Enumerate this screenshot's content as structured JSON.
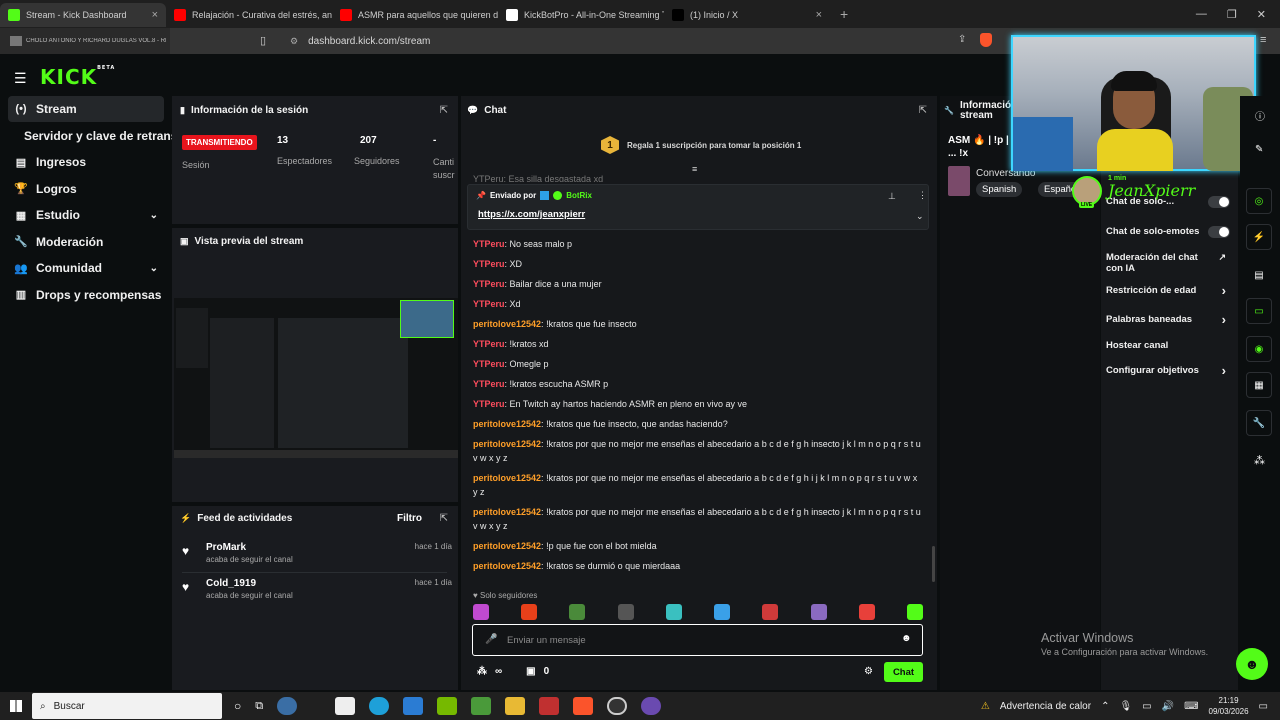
{
  "browser": {
    "tabs": [
      {
        "title": "Stream - Kick Dashboard",
        "color": "#53fc18",
        "active": true
      },
      {
        "title": "Relajación - Curativa del estrés, ansie",
        "color": "#ff0000",
        "active": false
      },
      {
        "title": "ASMR para aquellos que quieren dor",
        "color": "#ff0000",
        "active": false
      },
      {
        "title": "KickBotPro - All-in-One Streaming To",
        "color": "#ffffff",
        "active": false
      },
      {
        "title": "(1) Inicio / X",
        "color": "#000000",
        "active": false
      }
    ],
    "new_tab": "+",
    "url": "dashboard.kick.com/stream",
    "media_card": "CHOLO ANTONIO Y RICHARD DUGLAS VOL.8 - REDES SO..."
  },
  "brand": {
    "logo": "KICK",
    "beta": "BETA"
  },
  "sidebar": {
    "items": [
      {
        "label": "Stream",
        "icon": "(•)",
        "active": true
      },
      {
        "label": "Servidor y clave de retransm",
        "icon": "",
        "active": false
      },
      {
        "label": "Ingresos",
        "icon": "▤",
        "active": false
      },
      {
        "label": "Logros",
        "icon": "🏆",
        "active": false
      },
      {
        "label": "Estudio",
        "icon": "▦",
        "active": false,
        "chevron": true
      },
      {
        "label": "Moderación",
        "icon": "🔧",
        "active": false
      },
      {
        "label": "Comunidad",
        "icon": "👥",
        "active": false,
        "chevron": true
      },
      {
        "label": "Drops y recompensas",
        "icon": "▥",
        "active": false
      }
    ]
  },
  "session": {
    "title": "Información de la sesión",
    "status": "TRANSMITIENDO",
    "session_label": "Sesión",
    "viewers": "13",
    "viewers_label": "Espectadores",
    "followers": "207",
    "followers_label": "Seguidores",
    "extra": "-",
    "extra_label": "Canti suscr"
  },
  "preview": {
    "title": "Vista previa del stream"
  },
  "feed": {
    "title": "Feed de actividades",
    "filter": "Filtro",
    "items": [
      {
        "name": "ProMark",
        "action": "acaba de seguir el canal",
        "time": "hace 1 día"
      },
      {
        "name": "Cold_1919",
        "action": "acaba de seguir el canal",
        "time": "hace 1 día"
      }
    ]
  },
  "chat": {
    "title": "Chat",
    "gift_rank": "1",
    "gift_text": "Regala 1 suscripción para tomar la posición 1",
    "pinned_by": "Enviado por",
    "pinned_user": "BotRix",
    "pinned_link": "https://x.com/jeanxpierr",
    "partial_line": "YTPeru: Esa silla desgastada xd",
    "messages": [
      {
        "user": "YTPeru",
        "color": "red",
        "text": "No seas malo p"
      },
      {
        "user": "YTPeru",
        "color": "red",
        "text": "XD"
      },
      {
        "user": "YTPeru",
        "color": "red",
        "text": "Bailar dice a una mujer"
      },
      {
        "user": "YTPeru",
        "color": "red",
        "text": "Xd"
      },
      {
        "user": "peritolove12542",
        "color": "orange",
        "text": "!kratos que fue insecto"
      },
      {
        "user": "YTPeru",
        "color": "red",
        "text": "!kratos xd"
      },
      {
        "user": "YTPeru",
        "color": "red",
        "text": "Omegle p"
      },
      {
        "user": "YTPeru",
        "color": "red",
        "text": "!kratos escucha ASMR p"
      },
      {
        "user": "YTPeru",
        "color": "red",
        "text": "En Twitch ay hartos haciendo ASMR en pleno en vivo ay ve"
      },
      {
        "user": "peritolove12542",
        "color": "orange",
        "text": "!kratos que fue insecto, que andas haciendo?"
      },
      {
        "user": "peritolove12542",
        "color": "orange",
        "text": "!kratos por que no mejor me enseñas el abecedario a b c d e f g h insecto j k l m n o p q r s t u v w x y z"
      },
      {
        "user": "peritolove12542",
        "color": "orange",
        "text": "!kratos por que no mejor me enseñas el abecedario a b c d e f g h i j k l m n o p q r s t u v w x y z"
      },
      {
        "user": "peritolove12542",
        "color": "orange",
        "text": "!kratos por que no mejor me enseñas el abecedario a b c d e f g h insecto j k l m n o p q r s t u v w x y z"
      },
      {
        "user": "peritolove12542",
        "color": "orange",
        "text": "!p que fue con el bot mielda"
      },
      {
        "user": "peritolove12542",
        "color": "orange",
        "text": "!kratos se durmió o que mierdaaa"
      }
    ],
    "followers_only": "Solo seguidores",
    "input_placeholder": "Enviar un mensaje",
    "points_symbol": "∞",
    "points_count": "0",
    "send_label": "Chat"
  },
  "stream_info": {
    "title": "Información stream",
    "stream_title": "ASM 🔥 | !p | ... !x",
    "category": "Conversando",
    "tags": [
      "Spanish",
      "Español"
    ]
  },
  "webcam": {
    "name": "JeanXpierr",
    "time": "1 min",
    "live": "LIVE"
  },
  "moderation": {
    "items": [
      {
        "label": "Chat de solo-...",
        "type": "toggle"
      },
      {
        "label": "Chat de solo-emotes",
        "type": "toggle"
      },
      {
        "label": "Moderación del chat con IA",
        "type": "external"
      },
      {
        "label": "Restricción de edad",
        "type": "chevron"
      },
      {
        "label": "Palabras baneadas",
        "type": "chevron"
      },
      {
        "label": "Hostear canal",
        "type": "none"
      },
      {
        "label": "Configurar objetivos",
        "type": "chevron"
      }
    ]
  },
  "activation": {
    "title": "Activar Windows",
    "subtitle": "Ve a Configuración para activar Windows."
  },
  "taskbar": {
    "search": "Buscar",
    "weather": "Advertencia de calor",
    "time": "21:19",
    "date": "09/03/2026"
  }
}
